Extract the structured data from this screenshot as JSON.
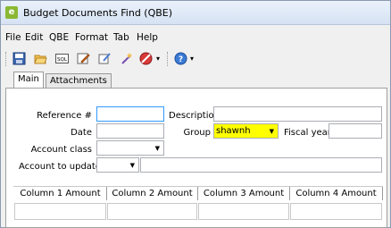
{
  "window": {
    "title": "Budget Documents Find (QBE)",
    "app_icon_letter": "e"
  },
  "menu": [
    "File",
    "Edit",
    "QBE",
    "Format",
    "Tab",
    "Help"
  ],
  "toolbar": {
    "icons": [
      "save-icon",
      "open-folder-icon",
      "sql-icon",
      "edit-icon",
      "clear-icon",
      "wizard-icon",
      "cancel-icon",
      "help-icon"
    ],
    "sql_text": "SQL",
    "dropdown_glyph": "▾"
  },
  "tabs": [
    {
      "label": "Main",
      "active": true
    },
    {
      "label": "Attachments",
      "active": false
    }
  ],
  "form": {
    "reference_label": "Reference #",
    "reference_value": "",
    "description_label": "Description",
    "description_value": "",
    "date_label": "Date",
    "date_value": "",
    "group_label": "Group",
    "group_value": "shawnh",
    "fiscal_year_label": "Fiscal year",
    "fiscal_year_value": "",
    "account_class_label": "Account class",
    "account_class_value": "",
    "account_to_update_label": "Account to update",
    "account_to_update_value": "",
    "dropdown_glyph": "▼"
  },
  "grid": {
    "headers": [
      "Column 1 Amount",
      "Column 2 Amount",
      "Column 3 Amount",
      "Column 4 Amount"
    ]
  },
  "colors": {
    "group_highlight": "#ffff00",
    "focus_border": "#3399ff"
  }
}
